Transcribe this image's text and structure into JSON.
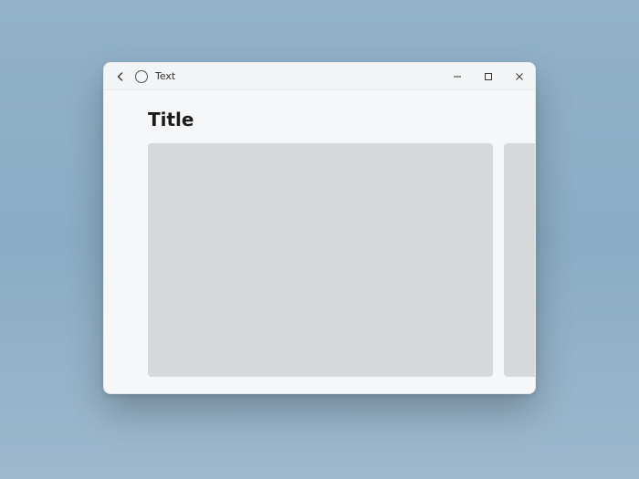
{
  "titlebar": {
    "title": "Text"
  },
  "page": {
    "heading": "Title"
  },
  "colors": {
    "desktop": "#8bacc5",
    "window_bg": "#f6f7f9",
    "card_bg": "#d6d8da",
    "text": "#1b1b1b"
  }
}
